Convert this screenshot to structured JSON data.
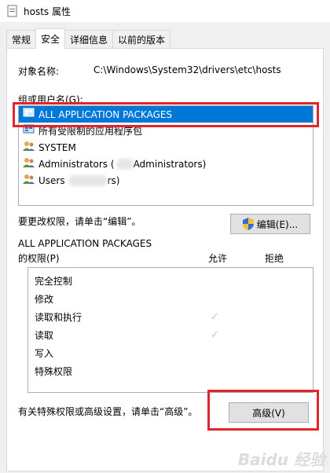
{
  "window": {
    "title": "hosts 属性"
  },
  "tabs": [
    {
      "label": "常规",
      "active": false
    },
    {
      "label": "安全",
      "active": true
    },
    {
      "label": "详细信息",
      "active": false
    },
    {
      "label": "以前的版本",
      "active": false
    }
  ],
  "object": {
    "label": "对象名称:",
    "value": "C:\\Windows\\System32\\drivers\\etc\\hosts"
  },
  "groups": {
    "label": "组或用户名(G):",
    "items": [
      {
        "icon": "package-group-icon",
        "name": "ALL APPLICATION PACKAGES",
        "selected": true
      },
      {
        "icon": "package-group-icon",
        "name": "所有受限制的应用程序包",
        "selected": false
      },
      {
        "icon": "users-group-icon",
        "name": "SYSTEM",
        "selected": false
      },
      {
        "icon": "users-group-icon",
        "name": "Administrators (",
        "suffix": "Administrators)",
        "selected": false
      },
      {
        "icon": "users-group-icon",
        "name": "Users",
        "suffix": "rs)",
        "selected": false
      }
    ]
  },
  "change": {
    "label": "要更改权限，请单击“编辑”。",
    "edit_button": "编辑(E)..."
  },
  "permissions": {
    "title": "ALL APPLICATION PACKAGES",
    "subtitle": "的权限(P)",
    "allow_col": "允许",
    "deny_col": "拒绝",
    "rows": [
      {
        "name": "完全控制",
        "allow": false
      },
      {
        "name": "修改",
        "allow": false
      },
      {
        "name": "读取和执行",
        "allow": true
      },
      {
        "name": "读取",
        "allow": true
      },
      {
        "name": "写入",
        "allow": false
      },
      {
        "name": "特殊权限",
        "allow": false
      }
    ]
  },
  "advanced": {
    "label": "有关特殊权限或高级设置，请单击“高级”。",
    "button": "高级(V)"
  },
  "watermark": "Baidu 经验"
}
